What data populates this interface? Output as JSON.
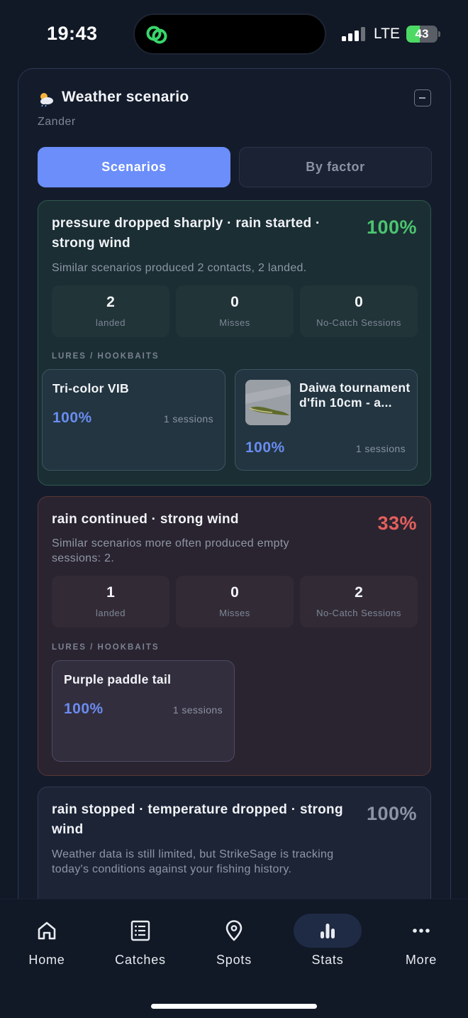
{
  "status_bar": {
    "time": "19:43",
    "network": "LTE",
    "battery": "43",
    "battery_level": 0.43
  },
  "panel": {
    "title": "Weather scenario",
    "subtitle": "Zander",
    "icon": "partly-cloudy-icon",
    "tabs": [
      {
        "label": "Scenarios",
        "active": true
      },
      {
        "label": "By factor",
        "active": false
      }
    ]
  },
  "scenarios": [
    {
      "title": "pressure dropped sharply · rain started · strong wind",
      "percent": "100%",
      "description": "Similar scenarios produced 2 contacts, 2 landed.",
      "stats": [
        {
          "value": "2",
          "label": "landed"
        },
        {
          "value": "0",
          "label": "Misses"
        },
        {
          "value": "0",
          "label": "No-Catch Sessions"
        }
      ],
      "section_label": "LURES / HOOKBAITS",
      "lures": [
        {
          "name": "Tri-color VIB",
          "percent": "100%",
          "sessions": "1 sessions"
        },
        {
          "name": "Daiwa tournament d'fin 10cm - a...",
          "percent": "100%",
          "sessions": "1 sessions"
        }
      ]
    },
    {
      "title": "rain continued · strong wind",
      "percent": "33%",
      "description": "Similar scenarios more often produced empty sessions: 2.",
      "stats": [
        {
          "value": "1",
          "label": "landed"
        },
        {
          "value": "0",
          "label": "Misses"
        },
        {
          "value": "2",
          "label": "No-Catch Sessions"
        }
      ],
      "section_label": "LURES / HOOKBAITS",
      "lures": [
        {
          "name": "Purple paddle tail",
          "percent": "100%",
          "sessions": "1 sessions"
        }
      ]
    },
    {
      "title": "rain stopped · temperature dropped · strong wind",
      "percent": "100%",
      "description": "Weather data is still limited, but StrikeSage is tracking today's conditions against your fishing history."
    }
  ],
  "nav": [
    {
      "label": "Home",
      "icon": "home-icon"
    },
    {
      "label": "Catches",
      "icon": "list-icon"
    },
    {
      "label": "Spots",
      "icon": "map-pin-icon"
    },
    {
      "label": "Stats",
      "icon": "bar-chart-icon",
      "active": true
    },
    {
      "label": "More",
      "icon": "more-dots-icon"
    }
  ]
}
